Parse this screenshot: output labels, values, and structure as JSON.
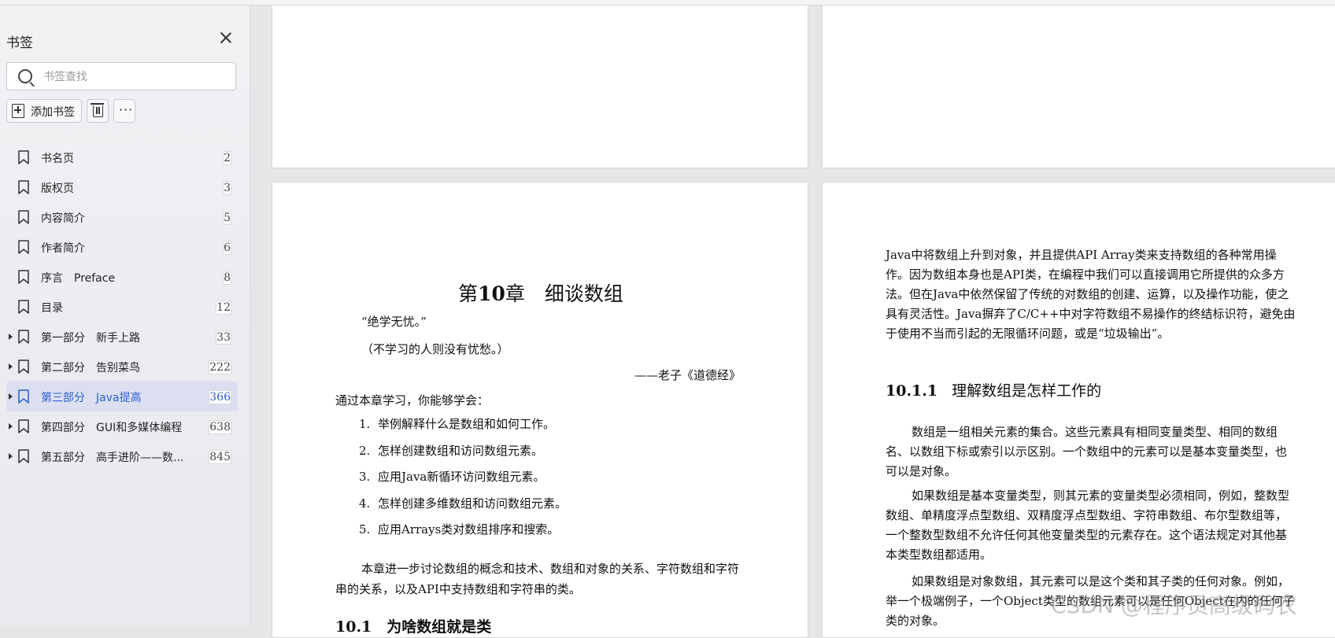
{
  "sidebar": {
    "title": "书签",
    "search_placeholder": "书签查找",
    "add_label": "添加书签",
    "items": [
      {
        "title": "书名页",
        "page": "2",
        "expandable": false,
        "active": false
      },
      {
        "title": "版权页",
        "page": "3",
        "expandable": false,
        "active": false
      },
      {
        "title": "内容简介",
        "page": "5",
        "expandable": false,
        "active": false
      },
      {
        "title": "作者简介",
        "page": "6",
        "expandable": false,
        "active": false
      },
      {
        "title": "序言　Preface",
        "page": "8",
        "expandable": false,
        "active": false
      },
      {
        "title": "目录",
        "page": "12",
        "expandable": false,
        "active": false
      },
      {
        "title": "第一部分　新手上路",
        "page": "33",
        "expandable": true,
        "active": false
      },
      {
        "title": "第二部分　告别菜鸟",
        "page": "222",
        "expandable": true,
        "active": false
      },
      {
        "title": "第三部分　Java提高",
        "page": "366",
        "expandable": true,
        "active": true
      },
      {
        "title": "第四部分　GUI和多媒体编程",
        "page": "638",
        "expandable": true,
        "active": false
      },
      {
        "title": "第五部分　高手进阶——数...",
        "page": "845",
        "expandable": true,
        "active": false
      }
    ]
  },
  "left_page": {
    "chapter_num": "10",
    "chapter_prefix": "第",
    "chapter_suffix": "章　细谈数组",
    "epigraph_1": "“绝学无忧。”",
    "epigraph_2": "（不学习的人则没有忧愁。）",
    "epigraph_3": "——老子《道德经》",
    "intro": "通过本章学习，你能够学会：",
    "goals": [
      {
        "n": "1.",
        "text": "举例解释什么是数组和如何工作。"
      },
      {
        "n": "2.",
        "text": "怎样创建数组和访问数组元素。"
      },
      {
        "n": "3.",
        "text": "应用Java新循环访问数组元素。"
      },
      {
        "n": "4.",
        "text": "怎样创建多维数组和访问数组元素。"
      },
      {
        "n": "5.",
        "text": "应用Arrays类对数组排序和搜索。"
      }
    ],
    "paragraph": "本章进一步讨论数组的概念和技术、数组和对象的关系、字符数组和字符串的关系，以及API中支持数组和字符串的类。",
    "section_heading": "10.1　为啥数组就是类"
  },
  "right_page": {
    "para1": "Java中将数组上升到对象，并且提供API Array类来支持数组的各种常用操作。因为数组本身也是API类，在编程中我们可以直接调用它所提供的众多方法。但在Java中依然保留了传统的对数组的创建、运算，以及操作功能，使之具有灵活性。Java摒弃了C/C++中对字符数组不易操作的终结标识符，避免由于使用不当而引起的无限循环问题，或是“垃圾输出”。",
    "section_num": "10.1.1",
    "section_title": "理解数组是怎样工作的",
    "para2": "数组是一组相关元素的集合。这些元素具有相同变量类型、相同的数组名、以数组下标或索引以示区别。一个数组中的元素可以是基本变量类型，也可以是对象。",
    "para3": "如果数组是基本变量类型，则其元素的变量类型必须相同，例如，整数型数组、单精度浮点型数组、双精度浮点型数组、字符串数组、布尔型数组等，一个整数型数组不允许任何其他变量类型的元素存在。这个语法规定对其他基本类型数组都适用。",
    "para4": "如果数组是对象数组，其元素可以是这个类和其子类的任何对象。例如，举一个极端例子，一个Object类型的数组元素可以是任何Object在内的任何子类的对象。"
  },
  "watermark": "CSDN @程序员高级码农"
}
